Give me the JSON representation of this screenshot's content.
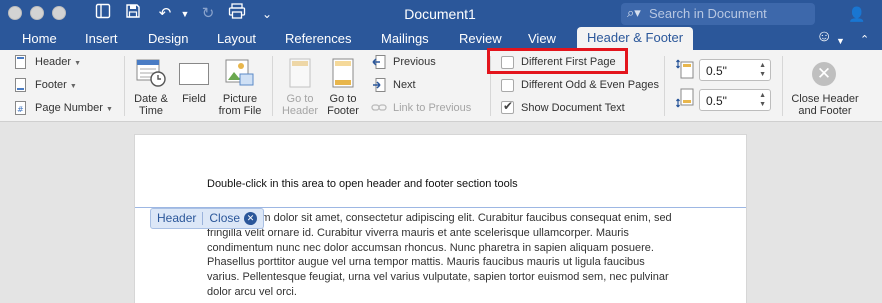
{
  "window": {
    "title": "Document1",
    "search_placeholder": "Search in Document"
  },
  "tabs": [
    "Home",
    "Insert",
    "Design",
    "Layout",
    "References",
    "Mailings",
    "Review",
    "View"
  ],
  "active_tab": "Header & Footer",
  "ribbon": {
    "header_label": "Header",
    "footer_label": "Footer",
    "page_number_label": "Page Number",
    "date_time_line1": "Date &",
    "date_time_line2": "Time",
    "field_label": "Field",
    "picture_line1": "Picture",
    "picture_line2": "from File",
    "goto_header_line1": "Go to",
    "goto_header_line2": "Header",
    "goto_footer_line1": "Go to",
    "goto_footer_line2": "Footer",
    "previous_label": "Previous",
    "next_label": "Next",
    "link_to_previous_label": "Link to Previous",
    "different_first_page_label": "Different First Page",
    "different_odd_even_label": "Different Odd & Even Pages",
    "show_document_text_label": "Show Document Text",
    "different_first_page_checked": false,
    "different_odd_even_checked": false,
    "show_document_text_checked": true,
    "header_from_top_value": "0.5\"",
    "footer_from_bottom_value": "0.5\"",
    "close_line1": "Close Header",
    "close_line2": "and Footer"
  },
  "document": {
    "header_instruction": "Double-click in this area to open header and footer section tools",
    "header_tag_label": "Header",
    "header_tag_close": "Close",
    "body_lines": [
      "Lorem ipsum dolor sit amet, consectetur adipiscing elit. Curabitur faucibus consequat enim, sed",
      "fringilla velit ornare id. Curabitur viverra mauris et ante scelerisque ullamcorper. Mauris",
      "condimentum nunc nec dolor accumsan rhoncus. Nunc pharetra in sapien aliquam posuere.",
      "Phasellus porttitor augue vel urna tempor mattis. Mauris faucibus mauris ut ligula faucibus",
      "varius. Pellentesque feugiat, urna vel varius vulputate, sapien tortor euismod sem, nec pulvinar",
      "dolor arcu vel orci."
    ]
  },
  "colors": {
    "brand": "#2b579a",
    "highlight": "#e3141c"
  }
}
